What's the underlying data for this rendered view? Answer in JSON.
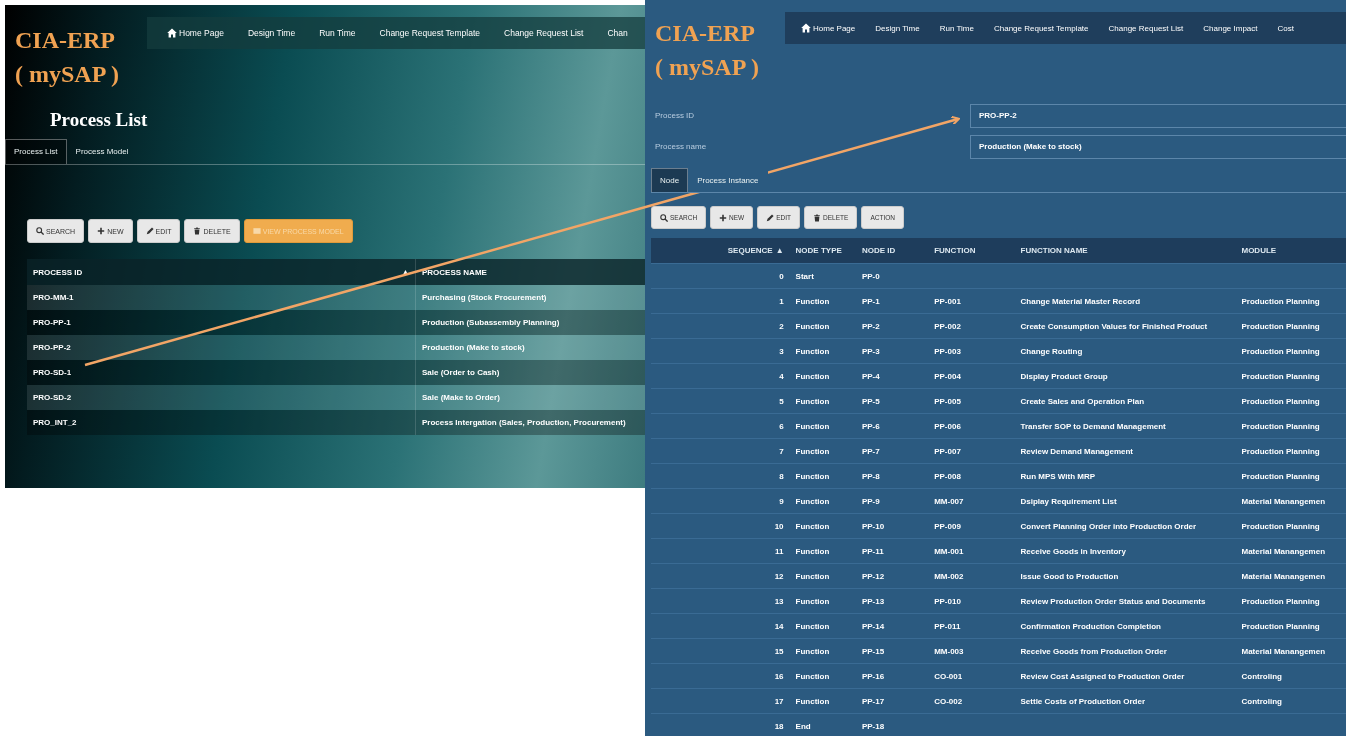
{
  "left_screen": {
    "logo": [
      "CIA-ERP",
      "( mySAP )"
    ],
    "nav": [
      {
        "label": "Home Page",
        "kind": "home"
      },
      {
        "label": "Design Time",
        "kind": "link"
      },
      {
        "label": "Run Time",
        "kind": "link"
      },
      {
        "label": "Change Request Template",
        "kind": "link"
      },
      {
        "label": "Change Request List",
        "kind": "link"
      },
      {
        "label": "Chan",
        "kind": "link"
      }
    ],
    "page_title": "Process List",
    "tabs": [
      {
        "label": "Process List",
        "selected": true
      },
      {
        "label": "Process Model",
        "selected": false
      }
    ],
    "buttons": [
      {
        "label": "SEARCH",
        "kind": "search",
        "highlighted": false
      },
      {
        "label": "NEW",
        "kind": "new",
        "highlighted": false
      },
      {
        "label": "EDIT",
        "kind": "edit",
        "highlighted": false
      },
      {
        "label": "DELETE",
        "kind": "delete",
        "highlighted": false
      },
      {
        "label": "VIEW PROCESS MODEL",
        "kind": "view",
        "highlighted": true
      }
    ],
    "table": {
      "columns": [
        {
          "label": "PROCESS ID",
          "sort": "▲"
        },
        {
          "label": "PROCESS NAME"
        }
      ],
      "rows": [
        [
          "PRO-MM-1",
          "Purchasing (Stock Procurement)"
        ],
        [
          "PRO-PP-1",
          "Production (Subassembly Planning)"
        ],
        [
          "PRO-PP-2",
          "Production (Make to stock)"
        ],
        [
          "PRO-SD-1",
          "Sale (Order to Cash)"
        ],
        [
          "PRO-SD-2",
          "Sale (Make to Order)"
        ],
        [
          "PRO_INT_2",
          "Process Intergation (Sales, Production, Procurement)"
        ]
      ]
    }
  },
  "right_screen": {
    "logo": [
      "CIA-ERP",
      "( mySAP )"
    ],
    "nav": [
      {
        "label": "Home Page",
        "kind": "home"
      },
      {
        "label": "Design Time",
        "kind": "link"
      },
      {
        "label": "Run Time",
        "kind": "link"
      },
      {
        "label": "Change Request Template",
        "kind": "link"
      },
      {
        "label": "Change Request List",
        "kind": "link"
      },
      {
        "label": "Change Impact",
        "kind": "link"
      },
      {
        "label": "Cost",
        "kind": "link"
      }
    ],
    "fields": [
      {
        "label": "Process ID",
        "value": "PRO-PP-2"
      },
      {
        "label": "Process name",
        "value": "Production (Make to stock)"
      }
    ],
    "tabs": [
      {
        "label": "Node",
        "selected": true
      },
      {
        "label": "Process Instance",
        "selected": false
      }
    ],
    "buttons": [
      {
        "label": "SEARCH",
        "kind": "search",
        "highlighted": false
      },
      {
        "label": "NEW",
        "kind": "new",
        "highlighted": false
      },
      {
        "label": "EDIT",
        "kind": "edit",
        "highlighted": false
      },
      {
        "label": "DELETE",
        "kind": "delete",
        "highlighted": false
      },
      {
        "label": "ACTION",
        "kind": "action",
        "highlighted": false
      }
    ],
    "table": {
      "columns": [
        {
          "label": "SEQUENCE",
          "sort": "▲"
        },
        {
          "label": "NODE TYPE"
        },
        {
          "label": "NODE ID"
        },
        {
          "label": "FUNCTION"
        },
        {
          "label": "FUNCTION NAME"
        },
        {
          "label": "MODULE"
        }
      ],
      "rows": [
        [
          "0",
          "Start",
          "PP-0",
          "",
          "",
          ""
        ],
        [
          "1",
          "Function",
          "PP-1",
          "PP-001",
          "Change Material Master Record",
          "Production Planning"
        ],
        [
          "2",
          "Function",
          "PP-2",
          "PP-002",
          "Create Consumption Values for Finished Product",
          "Production Planning"
        ],
        [
          "3",
          "Function",
          "PP-3",
          "PP-003",
          "Change Routing",
          "Production Planning"
        ],
        [
          "4",
          "Function",
          "PP-4",
          "PP-004",
          "Display Product Group",
          "Production Planning"
        ],
        [
          "5",
          "Function",
          "PP-5",
          "PP-005",
          "Create Sales and Operation Plan",
          "Production Planning"
        ],
        [
          "6",
          "Function",
          "PP-6",
          "PP-006",
          "Transfer SOP to Demand Management",
          "Production Planning"
        ],
        [
          "7",
          "Function",
          "PP-7",
          "PP-007",
          "Review Demand Management",
          "Production Planning"
        ],
        [
          "8",
          "Function",
          "PP-8",
          "PP-008",
          "Run MPS With MRP",
          "Production Planning"
        ],
        [
          "9",
          "Function",
          "PP-9",
          "MM-007",
          "Dsiplay Requirement List",
          "Material Manangemen"
        ],
        [
          "10",
          "Function",
          "PP-10",
          "PP-009",
          "Convert Planning Order into Production Order",
          "Production Planning"
        ],
        [
          "11",
          "Function",
          "PP-11",
          "MM-001",
          "Receive Goods in Inventory",
          "Material Manangemen"
        ],
        [
          "12",
          "Function",
          "PP-12",
          "MM-002",
          "Issue Good to Production",
          "Material Manangemen"
        ],
        [
          "13",
          "Function",
          "PP-13",
          "PP-010",
          "Review Production Order Status and Documents",
          "Production Planning"
        ],
        [
          "14",
          "Function",
          "PP-14",
          "PP-011",
          "Confirmation Production Completion",
          "Production Planning"
        ],
        [
          "15",
          "Function",
          "PP-15",
          "MM-003",
          "Receive Goods from Production Order",
          "Material Manangemen"
        ],
        [
          "16",
          "Function",
          "PP-16",
          "CO-001",
          "Review Cost Assigned to Production Order",
          "Controling"
        ],
        [
          "17",
          "Function",
          "PP-17",
          "CO-002",
          "Settle Costs of Production Order",
          "Controling"
        ],
        [
          "18",
          "End",
          "PP-18",
          "",
          "",
          ""
        ]
      ]
    }
  }
}
